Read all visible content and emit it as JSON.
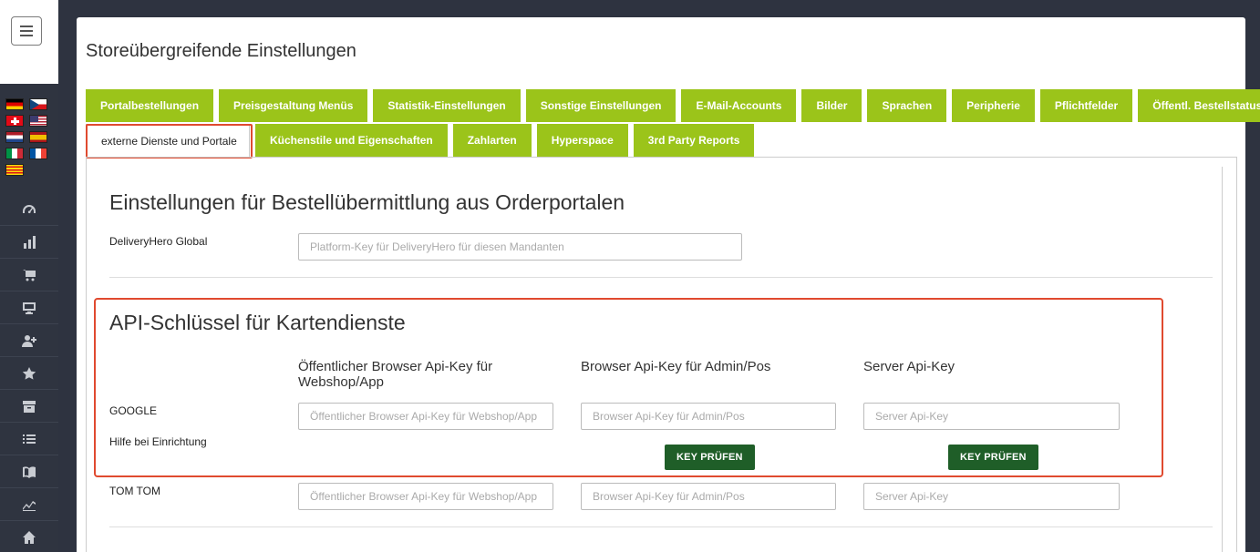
{
  "page": {
    "title": "Storeübergreifende Einstellungen"
  },
  "tabs_row1": [
    {
      "label": "Portalbestellungen"
    },
    {
      "label": "Preisgestaltung Menüs"
    },
    {
      "label": "Statistik-Einstellungen"
    },
    {
      "label": "Sonstige Einstellungen"
    },
    {
      "label": "E-Mail-Accounts"
    },
    {
      "label": "Bilder"
    },
    {
      "label": "Sprachen"
    },
    {
      "label": "Peripherie"
    },
    {
      "label": "Pflichtfelder"
    },
    {
      "label": "Öffentl. Bestellstatus"
    }
  ],
  "tabs_row2": [
    {
      "label": "externe Dienste und Portale",
      "active": true
    },
    {
      "label": "Küchenstile und Eigenschaften"
    },
    {
      "label": "Zahlarten"
    },
    {
      "label": "Hyperspace"
    },
    {
      "label": "3rd Party Reports"
    }
  ],
  "orderportals": {
    "title": "Einstellungen für Bestellübermittlung aus Orderportalen",
    "deliveryhero_label": "DeliveryHero Global",
    "deliveryhero_placeholder": "Platform-Key für DeliveryHero für diesen Mandanten",
    "deliveryhero_value": ""
  },
  "maps": {
    "title": "API-Schlüssel für Kartendienste",
    "columns": {
      "public": "Öffentlicher Browser Api-Key für Webshop/App",
      "admin": "Browser Api-Key für Admin/Pos",
      "server": "Server Api-Key"
    },
    "google": {
      "label": "GOOGLE",
      "help": "Hilfe bei Einrichtung",
      "public_placeholder": "Öffentlicher Browser Api-Key für Webshop/App",
      "admin_placeholder": "Browser Api-Key für Admin/Pos",
      "server_placeholder": "Server Api-Key",
      "check_button": "KEY PRÜFEN"
    },
    "tomtom": {
      "label": "TOM TOM",
      "public_placeholder": "Öffentlicher Browser Api-Key für Webshop/App",
      "admin_placeholder": "Browser Api-Key für Admin/Pos",
      "server_placeholder": "Server Api-Key"
    }
  },
  "sidebar": {
    "flags": [
      "flag-de-icon",
      "flag-cz-icon",
      "flag-ch-icon",
      "flag-us-icon",
      "flag-nl-icon",
      "flag-es-icon",
      "flag-it-icon",
      "flag-fr-icon",
      "flag-catalonia-icon"
    ],
    "nav_icons": [
      "dashboard-icon",
      "bar-chart-icon",
      "cart-icon",
      "monitor-icon",
      "add-user-icon",
      "star-icon",
      "archive-icon",
      "list-icon",
      "book-icon",
      "line-chart-icon",
      "home-icon"
    ]
  },
  "colors": {
    "tab_green": "#9bc41a",
    "button_green": "#1f5e28",
    "highlight_red": "#e04a2f",
    "sidebar_bg": "#2f3440"
  }
}
